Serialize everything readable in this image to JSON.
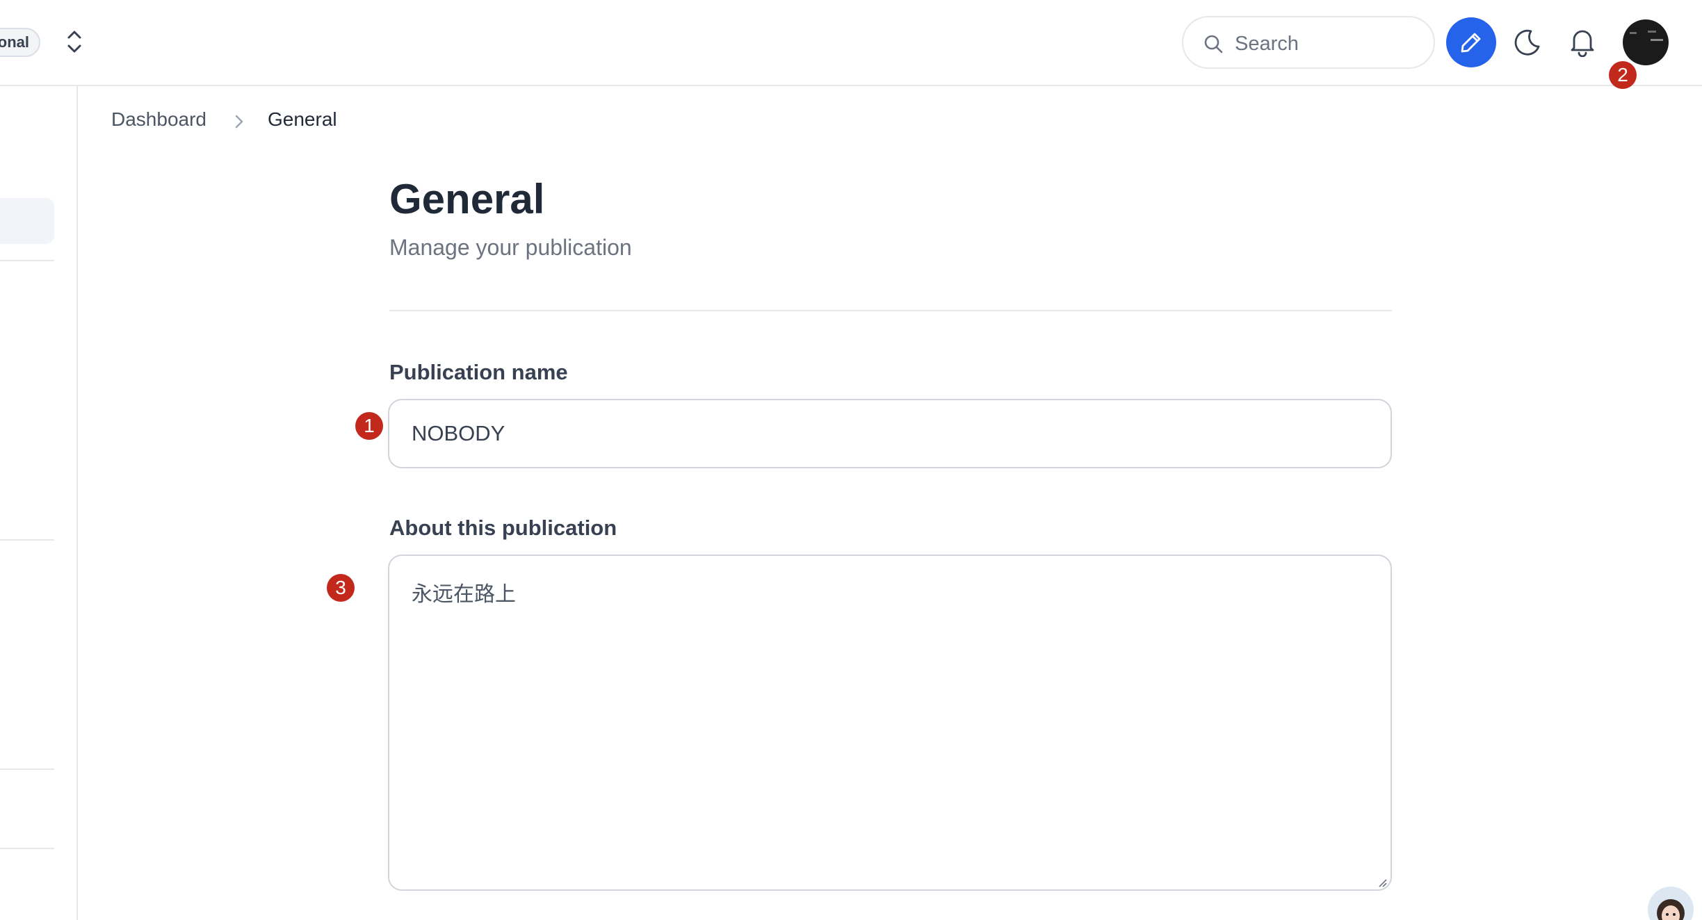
{
  "header": {
    "publication_switcher_label": "onal",
    "search_placeholder": "Search",
    "icons": [
      "chevron-up-down-icon",
      "search-icon",
      "pencil-icon",
      "moon-icon",
      "bell-icon"
    ],
    "accent_color": "#2563eb"
  },
  "breadcrumb": {
    "items": [
      "Dashboard",
      "General"
    ]
  },
  "main": {
    "title": "General",
    "subtitle": "Manage your publication",
    "fields": {
      "publication_name": {
        "label": "Publication name",
        "value": "NOBODY"
      },
      "about": {
        "label": "About this publication",
        "value": "永远在路上"
      }
    }
  },
  "markers": [
    "1",
    "2",
    "3"
  ],
  "marker_color": "#c3281d"
}
